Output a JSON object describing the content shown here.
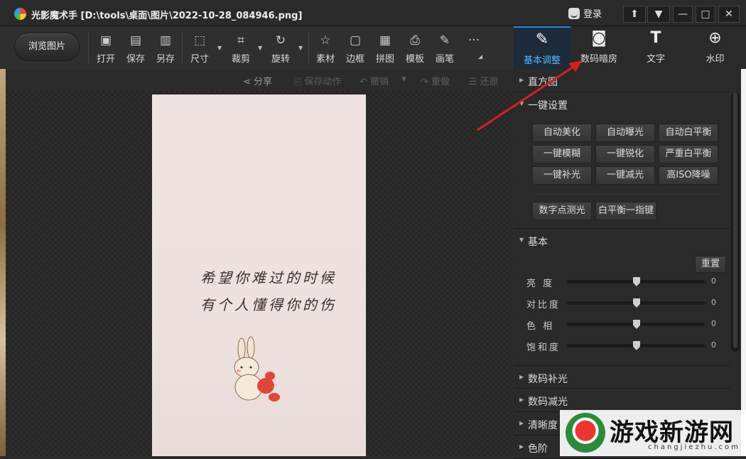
{
  "title": "光影魔术手 [D:\\tools\\桌面\\图片\\2022-10-28_084946.png]",
  "login_label": "登录",
  "window_controls": [
    "⬆",
    "▼",
    "—",
    "□",
    "✕"
  ],
  "toolbar": {
    "browse_label": "浏览图片",
    "tools": [
      "打开",
      "保存",
      "另存",
      "尺寸",
      "裁剪",
      "旋转",
      "素材",
      "边框",
      "拼图",
      "模板",
      "画笔"
    ],
    "more_label": "···"
  },
  "right_tabs": [
    "基本调整",
    "数码暗房",
    "文字",
    "水印"
  ],
  "subbar": {
    "share": "分享",
    "save_action": "保存动作",
    "undo": "撤销",
    "redo": "重做",
    "restore": "还原"
  },
  "photo": {
    "line1": "希望你难过的时候",
    "line2": "有个人懂得你的伤"
  },
  "panel": {
    "histogram": "直方图",
    "one_key": "一键设置",
    "buttons": [
      "自动美化",
      "自动曝光",
      "自动白平衡",
      "一键模糊",
      "一键锐化",
      "严重白平衡",
      "一键补光",
      "一键减光",
      "高ISO降噪"
    ],
    "buttons2": [
      "数字点测光",
      "白平衡一指键"
    ],
    "basic": "基本",
    "reset": "重置",
    "sliders": [
      {
        "label": "亮  度",
        "value": "0"
      },
      {
        "label": "对比度",
        "value": "0"
      },
      {
        "label": "色  相",
        "value": "0"
      },
      {
        "label": "饱和度",
        "value": "0"
      }
    ],
    "fill_light": "数码补光",
    "reduce_light": "数码减光",
    "clarity": "清晰度",
    "levels": "色阶"
  },
  "watermark": {
    "text": "游戏新游网",
    "url": "changjiezhu.com"
  },
  "colors": {
    "accent": "#2f8be8",
    "annotation_arrow": "#d42020"
  }
}
